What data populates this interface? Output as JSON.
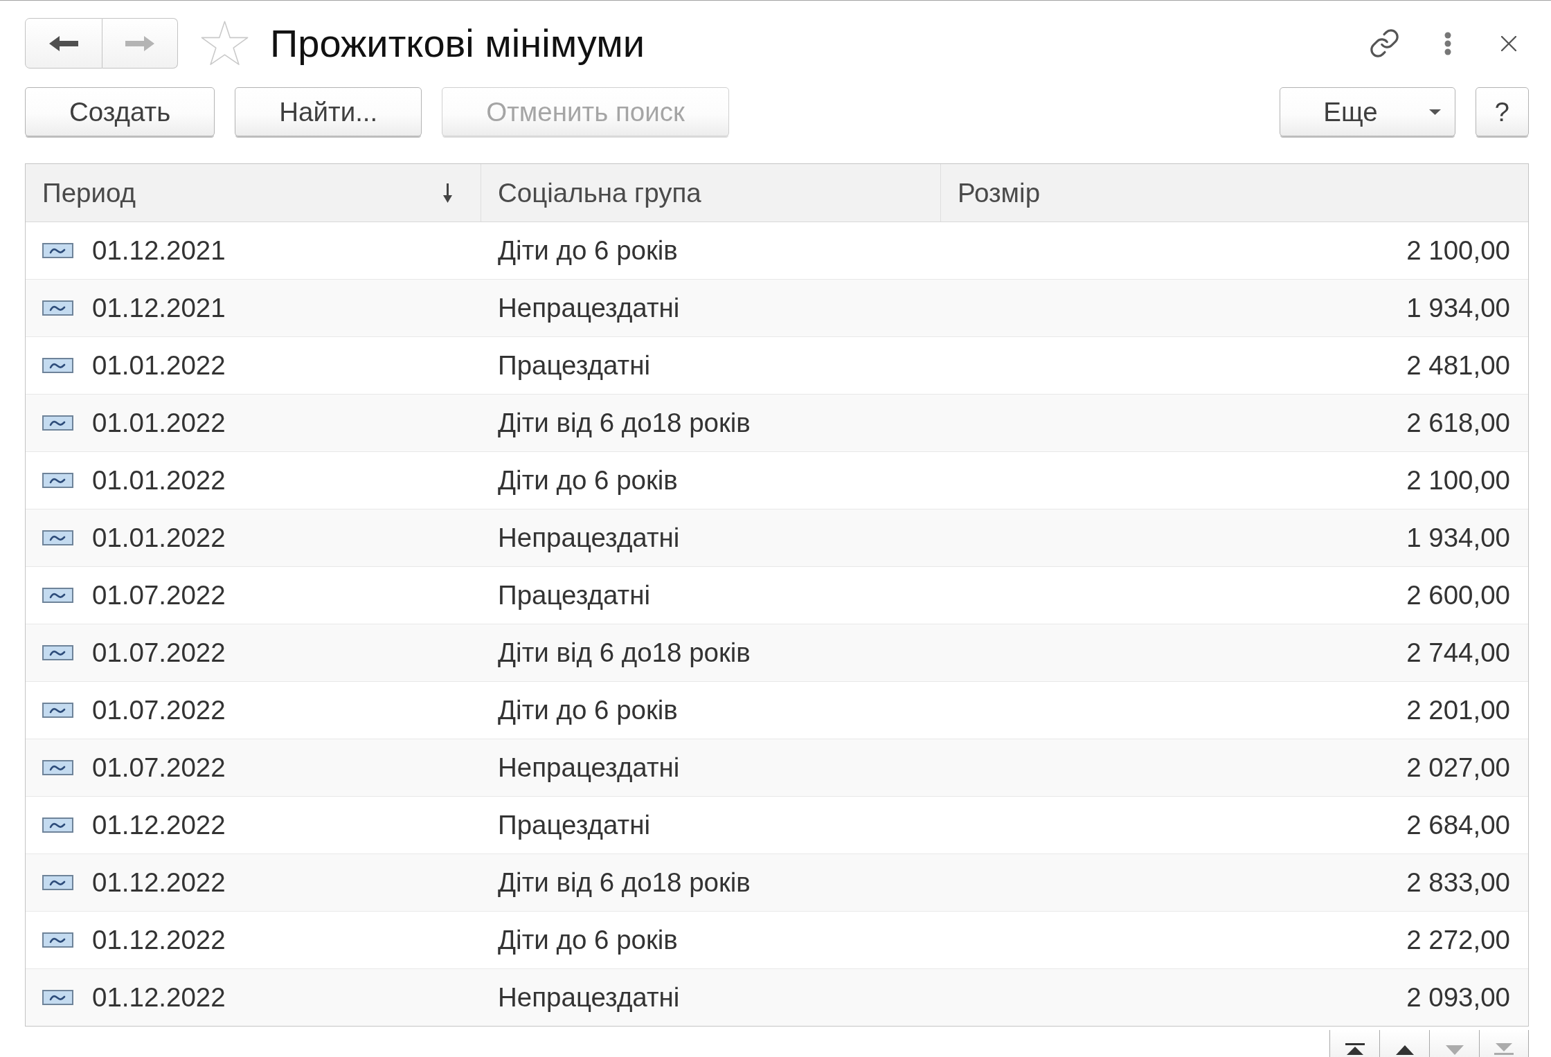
{
  "window": {
    "title": "Прожиткові мінімуми",
    "favorite": false
  },
  "navigation": [
    {
      "kind": "back",
      "disabled": false
    },
    {
      "kind": "forward",
      "disabled": true
    }
  ],
  "command_bar": {
    "buttons": [
      {
        "label": "Создать",
        "disabled": false
      },
      {
        "label": "Найти...",
        "disabled": false
      },
      {
        "label": "Отменить поиск",
        "disabled": true
      }
    ],
    "more": {
      "label": "Еще"
    },
    "help": {
      "label": "?"
    }
  },
  "table": {
    "columns": [
      {
        "label": "Период",
        "sorted": true
      },
      {
        "label": "Соціальна група",
        "sorted": false
      },
      {
        "label": "Розмір",
        "sorted": false
      }
    ],
    "rows": [
      {
        "period": "01.12.2021",
        "social_group": "Діти до 6 років",
        "amount": "2 100,00",
        "selected": false
      },
      {
        "period": "01.12.2021",
        "social_group": "Непрацездатні",
        "amount": "1 934,00",
        "selected": false
      },
      {
        "period": "01.01.2022",
        "social_group": "Працездатні",
        "amount": "2 481,00",
        "selected": false
      },
      {
        "period": "01.01.2022",
        "social_group": "Діти від 6 до18 років",
        "amount": "2 618,00",
        "selected": false
      },
      {
        "period": "01.01.2022",
        "social_group": "Діти до 6 років",
        "amount": "2 100,00",
        "selected": false
      },
      {
        "period": "01.01.2022",
        "social_group": "Непрацездатні",
        "amount": "1 934,00",
        "selected": false
      },
      {
        "period": "01.07.2022",
        "social_group": "Працездатні",
        "amount": "2 600,00",
        "selected": false
      },
      {
        "period": "01.07.2022",
        "social_group": "Діти від 6 до18 років",
        "amount": "2 744,00",
        "selected": false
      },
      {
        "period": "01.07.2022",
        "social_group": "Діти до 6 років",
        "amount": "2 201,00",
        "selected": false
      },
      {
        "period": "01.07.2022",
        "social_group": "Непрацездатні",
        "amount": "2 027,00",
        "selected": false
      },
      {
        "period": "01.12.2022",
        "social_group": "Працездатні",
        "amount": "2 684,00",
        "selected": false
      },
      {
        "period": "01.12.2022",
        "social_group": "Діти від 6 до18 років",
        "amount": "2 833,00",
        "selected": false
      },
      {
        "period": "01.12.2022",
        "social_group": "Діти до 6 років",
        "amount": "2 272,00",
        "selected": false
      },
      {
        "period": "01.12.2022",
        "social_group": "Непрацездатні",
        "amount": "2 093,00",
        "selected": false
      }
    ]
  },
  "table_navigation": [
    {
      "kind": "first",
      "disabled": false
    },
    {
      "kind": "previous",
      "disabled": false
    },
    {
      "kind": "next",
      "disabled": true
    },
    {
      "kind": "last",
      "disabled": true
    }
  ]
}
